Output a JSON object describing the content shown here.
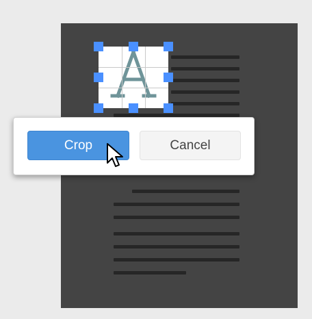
{
  "dialog": {
    "crop_label": "Crop",
    "cancel_label": "Cancel"
  },
  "document": {
    "image_letter": "A"
  },
  "icons": {
    "cursor": "arrow-cursor-icon"
  },
  "colors": {
    "accent": "#4a94e0",
    "handle": "#4a90ff",
    "page": "#444444",
    "text_lines": "#262626",
    "background": "#ebebeb"
  }
}
